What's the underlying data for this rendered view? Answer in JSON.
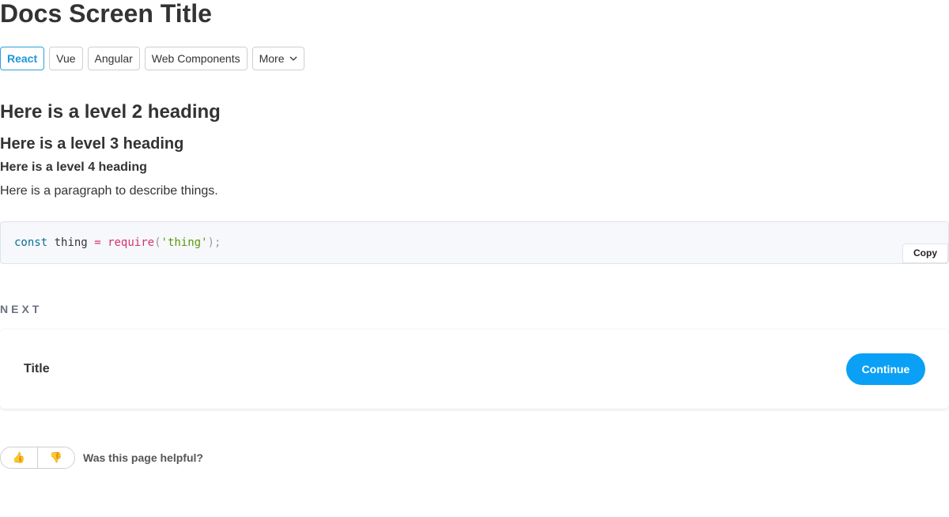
{
  "page": {
    "title": "Docs Screen Title"
  },
  "tabs": [
    {
      "label": "React",
      "active": true
    },
    {
      "label": "Vue",
      "active": false
    },
    {
      "label": "Angular",
      "active": false
    },
    {
      "label": "Web Components",
      "active": false
    },
    {
      "label": "More",
      "active": false,
      "icon": "chevron-down-icon"
    }
  ],
  "content": {
    "h2": "Here is a level 2 heading",
    "h3": "Here is a level 3 heading",
    "h4": "Here is a level 4 heading",
    "paragraph": "Here is a paragraph to describe things."
  },
  "code": {
    "tokens": {
      "keyword": "const",
      "name": "thing",
      "operator": "=",
      "function": "require",
      "open_paren": "(",
      "string": "'thing'",
      "close": ");"
    },
    "copy_label": "Copy"
  },
  "next": {
    "label": "NEXT",
    "title": "Title",
    "button_label": "Continue"
  },
  "feedback": {
    "thumbs_up": "👍",
    "thumbs_down": "👎",
    "question": "Was this page helpful?"
  },
  "colors": {
    "accent": "#0aa0f5",
    "active_tab": "#1e96d8"
  }
}
